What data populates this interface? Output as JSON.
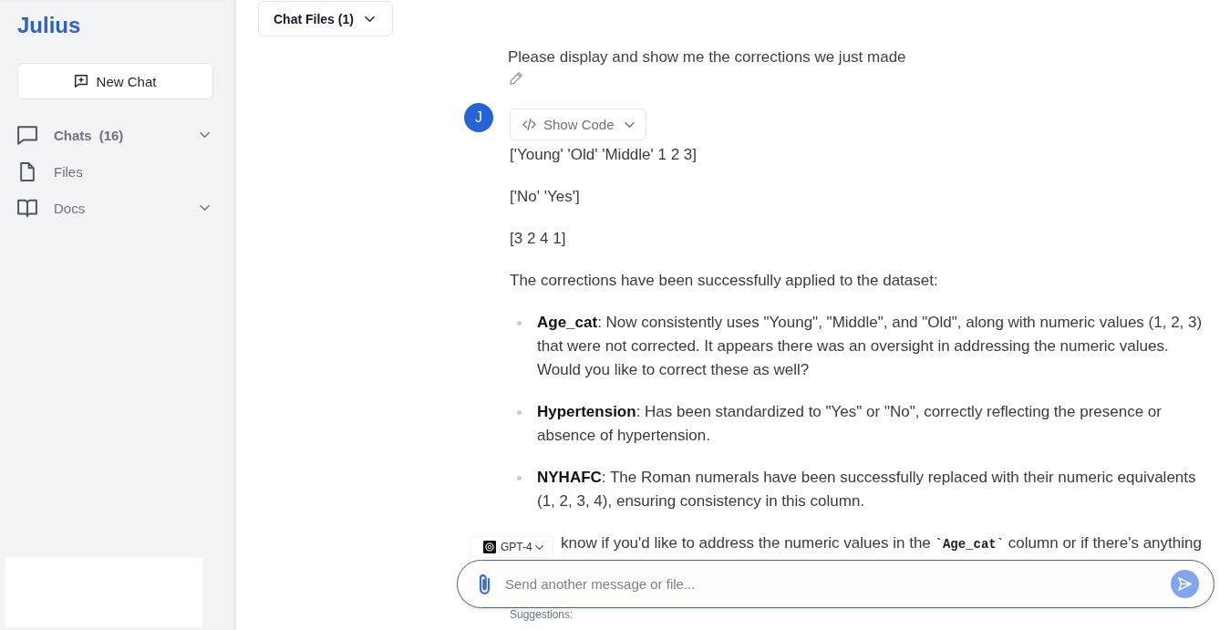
{
  "sidebar": {
    "logo": "Julius",
    "new_chat_button": "New Chat",
    "items": [
      {
        "label": "Chats",
        "count": "(16)",
        "kind": "group"
      },
      {
        "label": "Files",
        "kind": "link"
      },
      {
        "label": "Docs",
        "kind": "group"
      }
    ]
  },
  "header": {
    "chat_files_button": "Chat Files (1)"
  },
  "conversation": {
    "user_message": "Please display and show me the corrections we just made",
    "assistant": {
      "avatar": "J",
      "show_code_button": "Show Code",
      "outputs": [
        "['Young' 'Old' 'Middle' 1 2 3]",
        "['No' 'Yes']",
        "[3 2 4 1]"
      ],
      "intro": "The corrections have been successfully applied to the dataset:",
      "bullets": [
        "**Age_cat**: Now consistently uses \"Young\", \"Middle\", and \"Old\", along with numeric values (1, 2, 3) that were not corrected. It appears there was an oversight in addressing the numeric values. Would you like to correct these as well?",
        "**Hypertension**: Has been standardized to \"Yes\" or \"No\", correctly reflecting the presence or absence of hypertension.",
        "**NYHAFC**: The Roman numerals have been successfully replaced with their numeric equivalents (1, 2, 3, 4), ensuring consistency in this column."
      ],
      "closing": [
        {
          "kind": "text",
          "text": "know if you'd like to address the numeric values in the "
        },
        {
          "kind": "code",
          "text": "`Age_cat`"
        },
        {
          "kind": "text",
          "text": " column or if there's anything"
        }
      ]
    }
  },
  "composer": {
    "model": "GPT-4",
    "placeholder": "Send another message or file...",
    "suggestions_label": "Suggestions:"
  }
}
